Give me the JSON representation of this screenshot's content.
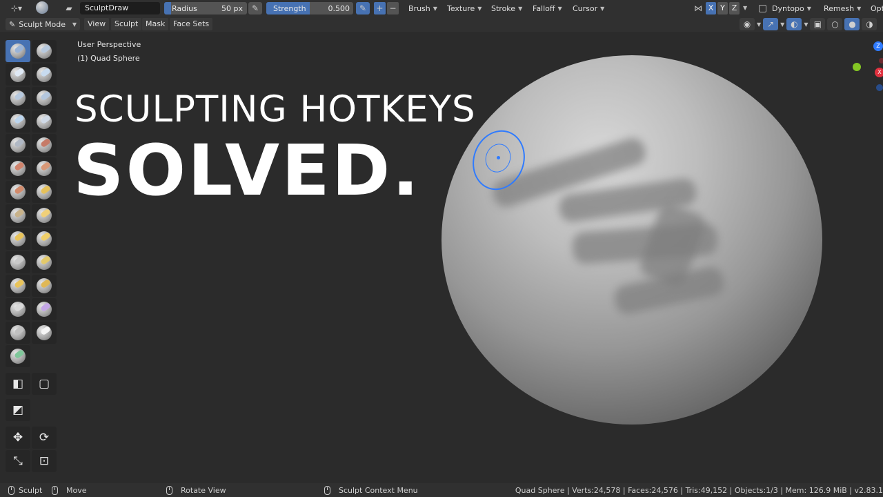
{
  "topbar": {
    "brush_name": "SculptDraw",
    "radius_label": "Radius",
    "radius_value": "50 px",
    "radius_fraction": 0.08,
    "strength_label": "Strength",
    "strength_value": "0.500",
    "strength_fraction": 0.5,
    "plus_label": "+",
    "minus_label": "−",
    "menus": [
      "Brush",
      "Texture",
      "Stroke",
      "Falloff",
      "Cursor"
    ],
    "axis_x": "X",
    "axis_y": "Y",
    "axis_z": "Z",
    "dyntopo_label": "Dyntopo",
    "remesh_label": "Remesh",
    "options_label": "Opt"
  },
  "header": {
    "mode_label": "Sculpt Mode",
    "menus": [
      "View",
      "Sculpt",
      "Mask",
      "Face Sets"
    ]
  },
  "viewport": {
    "perspective_label": "User Perspective",
    "object_label": "(1) Quad Sphere",
    "headline_1": "SCULPTING HOTKEYS",
    "headline_2": "SOLVED."
  },
  "gizmo": {
    "z_label": "Z",
    "x_label": "X"
  },
  "statusbar": {
    "left_mode": "Sculpt",
    "move_label": "Move",
    "rotate_label": "Rotate View",
    "context_label": "Sculpt Context Menu",
    "stats": "Quad Sphere | Verts:24,578 | Faces:24,576 | Tris:49,152 | Objects:1/3 | Mem: 126.9 MiB | v2.83.1"
  },
  "colors": {
    "accent": "#4772b3",
    "brush_cursor": "#2f7bff",
    "panel": "#303030",
    "viewport": "#2b2b2b"
  },
  "icons": [
    "editor-type-icon",
    "brush-preview-icon",
    "pen-pressure-icon",
    "axis-lock",
    "dyntopo-checkbox-icon",
    "viewport-shading-icons",
    "navigation-gizmo"
  ]
}
